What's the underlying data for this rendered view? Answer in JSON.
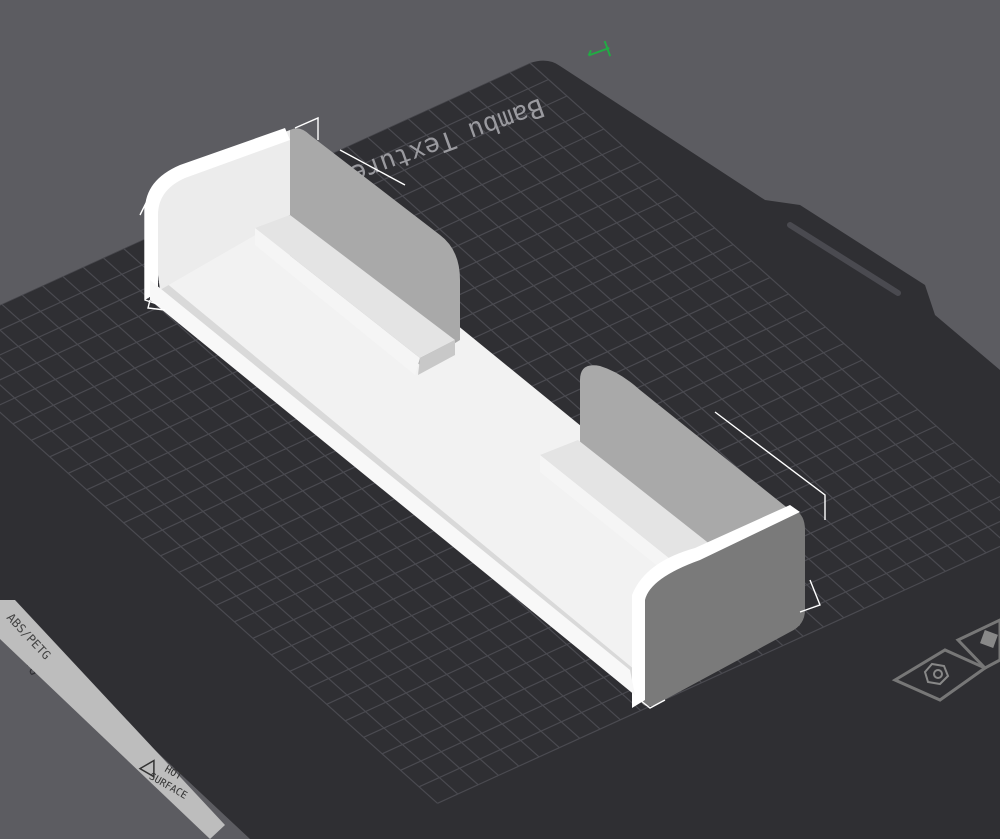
{
  "app": {
    "name": "3D slicer viewport",
    "background_color": "#5c5c61"
  },
  "plate": {
    "texture_label": "Bambu Texture",
    "material_label": "ABS/PETG",
    "warning_label_line1": "HOT",
    "warning_label_line2": "SURFACE",
    "warning_icon": "warning-triangle-icon",
    "plate_color": "#2f2f33",
    "grid_color": "#4a4a50"
  },
  "model": {
    "color": "#e8e8e8",
    "selected": true
  },
  "overlay_buttons": [
    {
      "name": "plate-settings-button",
      "icon": "hexagon-nut-icon"
    },
    {
      "name": "plate-options-button",
      "icon": "square-icon"
    }
  ],
  "gizmo": {
    "axis_icon": "axis-origin-icon",
    "color": "#22aa44"
  }
}
